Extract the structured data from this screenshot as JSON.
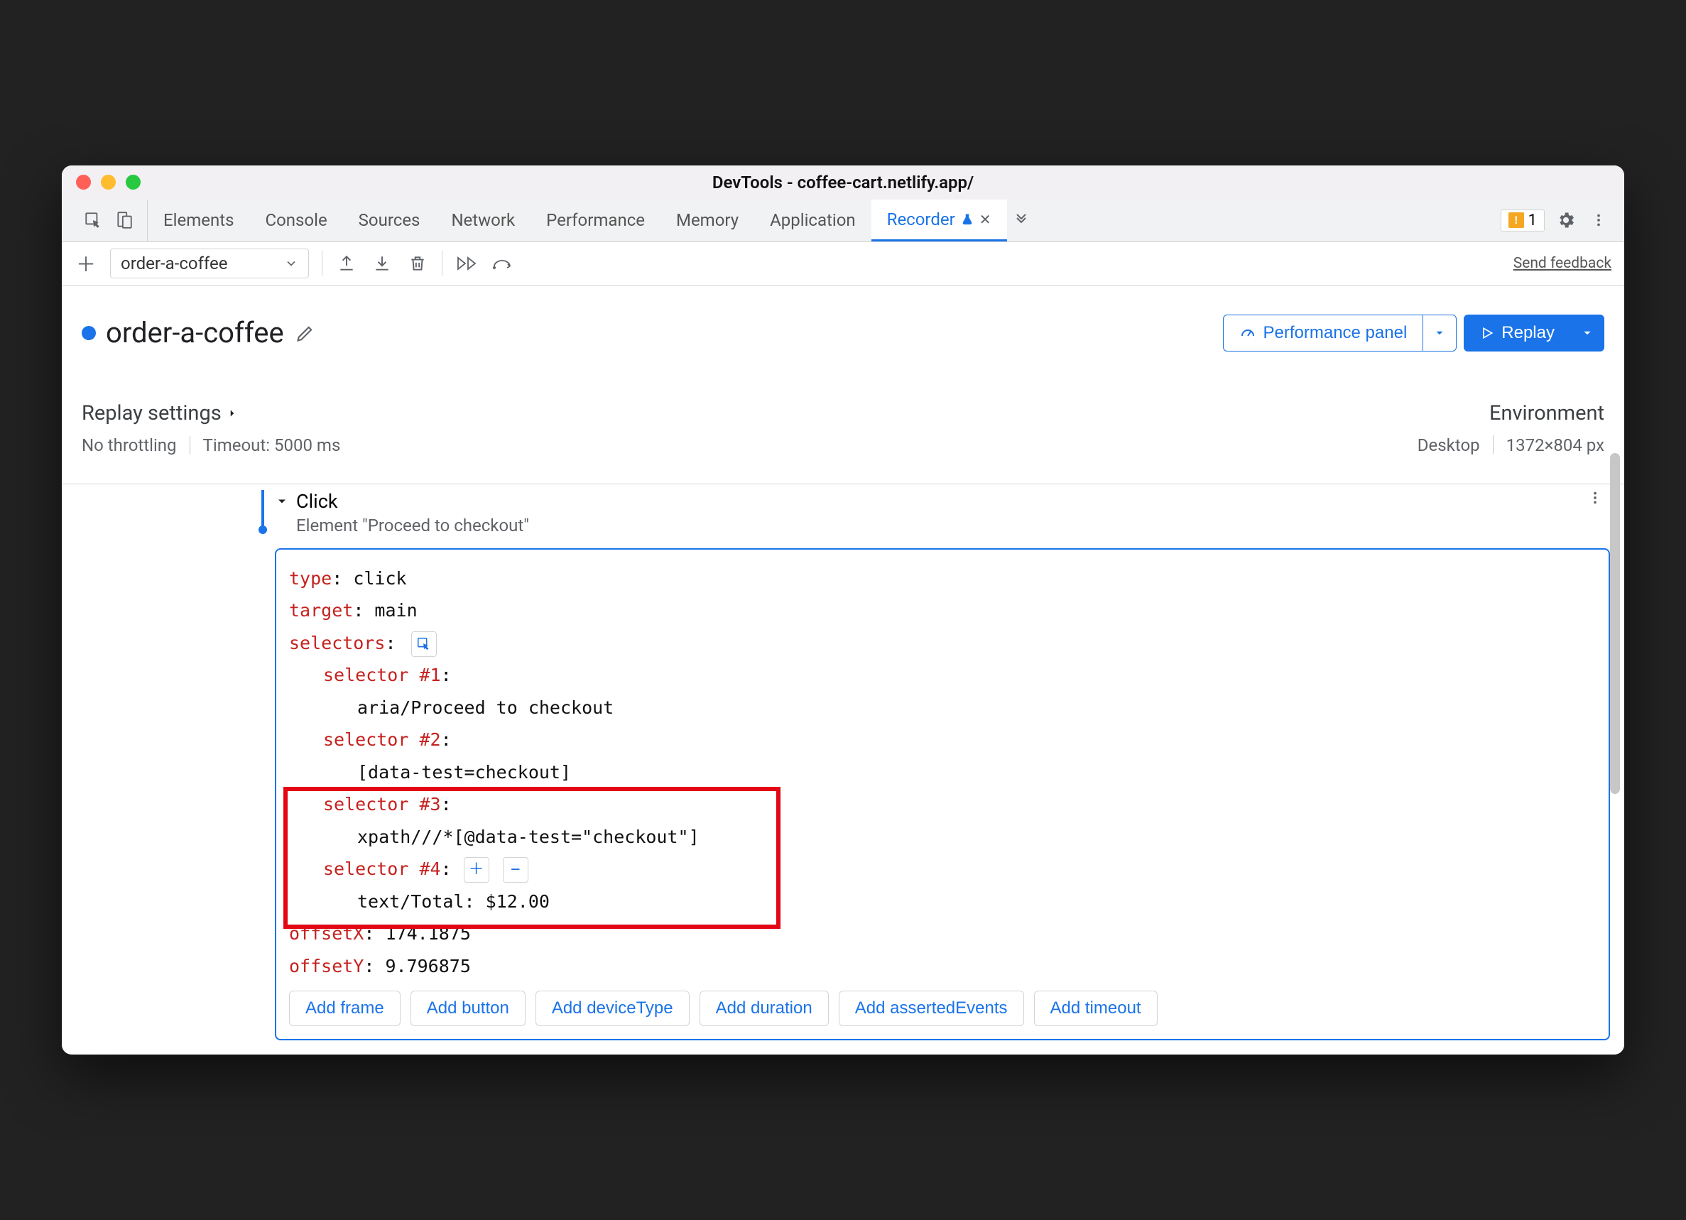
{
  "window": {
    "title": "DevTools - coffee-cart.netlify.app/"
  },
  "tabs": {
    "items": [
      "Elements",
      "Console",
      "Sources",
      "Network",
      "Performance",
      "Memory",
      "Application",
      "Recorder"
    ],
    "activeIndex": 7,
    "warnCount": "1"
  },
  "toolbar": {
    "recording_name": "order-a-coffee",
    "feedback": "Send feedback"
  },
  "header": {
    "recording_name": "order-a-coffee",
    "perf_panel": "Performance panel",
    "replay": "Replay"
  },
  "settings": {
    "replay_label": "Replay settings",
    "throttling": "No throttling",
    "timeout": "Timeout: 5000 ms",
    "env_label": "Environment",
    "env_device": "Desktop",
    "env_dims": "1372×804 px"
  },
  "step": {
    "title": "Click",
    "subtitle": "Element \"Proceed to checkout\"",
    "type_key": "type",
    "type_val": "click",
    "target_key": "target",
    "target_val": "main",
    "selectors_key": "selectors",
    "sel1_key": "selector #1",
    "sel1_val": "aria/Proceed to checkout",
    "sel2_key": "selector #2",
    "sel2_val": "[data-test=checkout]",
    "sel3_key": "selector #3",
    "sel3_val": "xpath///*[@data-test=\"checkout\"]",
    "sel4_key": "selector #4",
    "sel4_val": "text/Total: $12.00",
    "offsetx_key": "offsetX",
    "offsetx_val": "174.1875",
    "offsety_key": "offsetY",
    "offsety_val": "9.796875"
  },
  "chips": [
    "Add frame",
    "Add button",
    "Add deviceType",
    "Add duration",
    "Add assertedEvents",
    "Add timeout"
  ]
}
